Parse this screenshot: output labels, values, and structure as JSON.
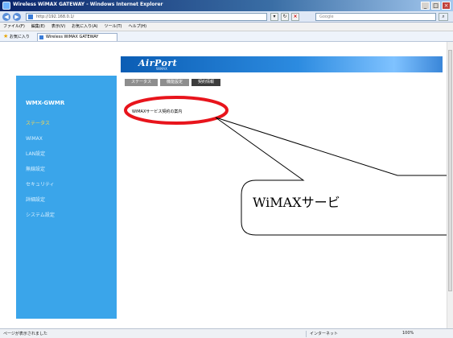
{
  "window": {
    "title": "Wireless WiMAX GATEWAY - Windows Internet Explorer",
    "controls": {
      "minimize": "_",
      "maximize": "□",
      "close": "×"
    }
  },
  "address_bar": {
    "back_icon": "◀",
    "forward_icon": "▶",
    "url": "http://192.168.0.1/",
    "dropdown_icon": "▾",
    "refresh_icon": "↻",
    "stop_icon": "×",
    "search_placeholder": "Google",
    "search_icon": "⌕"
  },
  "menu_bar": {
    "items": [
      "ファイル(F)",
      "編集(E)",
      "表示(V)",
      "お気に入り(A)",
      "ツール(T)",
      "ヘルプ(H)"
    ]
  },
  "favorites_bar": {
    "favorites_label": "お気に入り",
    "tab_label": "Wireless WiMAX GATEWAY"
  },
  "page": {
    "logo": "AirPort",
    "logo_sub": "WiMAX",
    "tabs": [
      "ステータス",
      "機能設定",
      "契約情報"
    ],
    "active_tab_index": 2,
    "sidebar": {
      "model": "WMX-GWMR",
      "items": [
        "ステータス",
        "WiMAX",
        "LAN設定",
        "無線設定",
        "セキュリティ",
        "詳細設定",
        "システム設定"
      ],
      "active_index": 0
    },
    "content_link": "WiMAXサービス契約の案内"
  },
  "annotation": {
    "callout_text": "WiMAXサービ",
    "ellipse_color": "#e8141c"
  },
  "status_bar": {
    "text": "ページが表示されました",
    "zone": "インターネット",
    "zoom": "100%"
  },
  "colors": {
    "sidebar": "#3aa5ea",
    "sidebar_active_item": "#ffd84a",
    "tab_inactive": "#8e8e8e",
    "tab_active": "#3d3d3d"
  }
}
